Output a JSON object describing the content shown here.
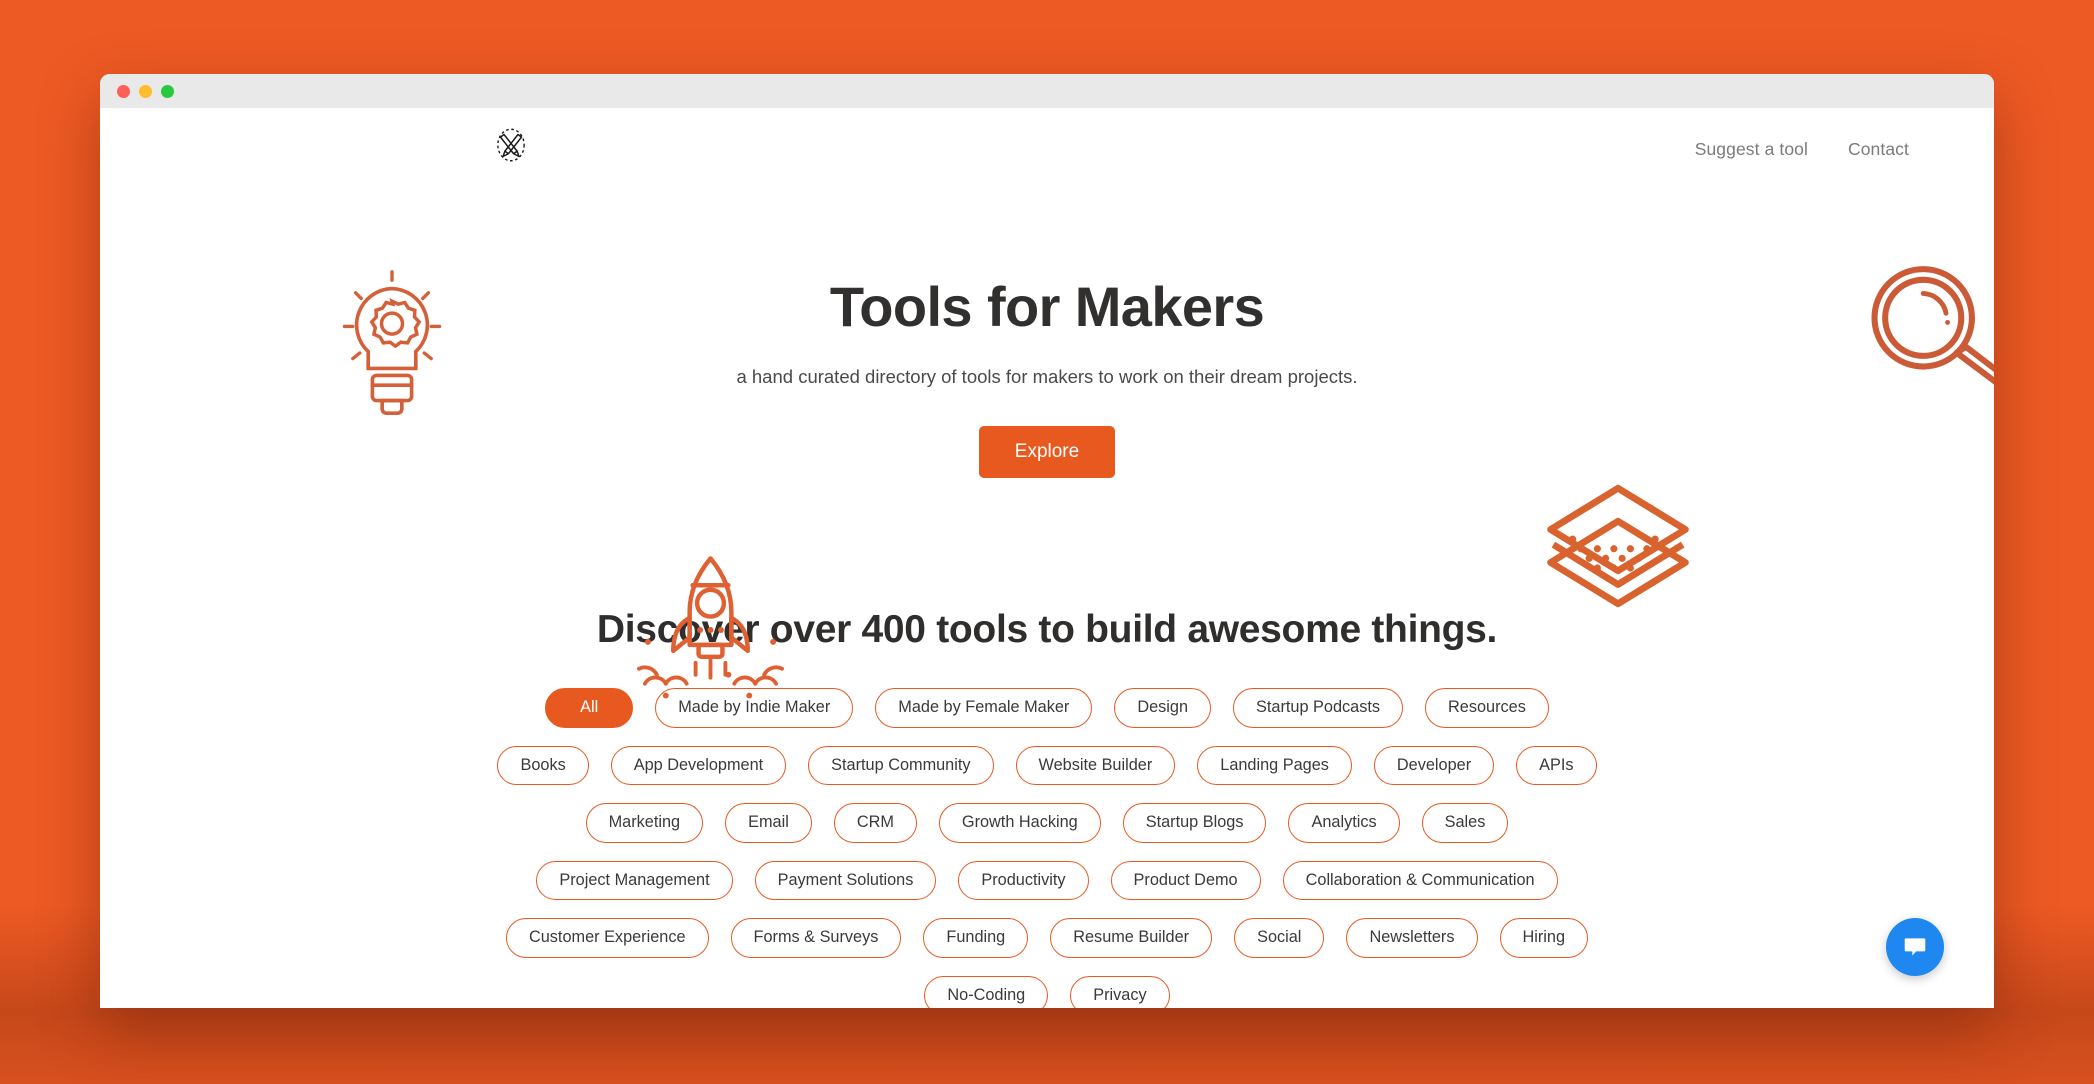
{
  "window": {
    "traffic_lights": [
      "close",
      "minimize",
      "maximize"
    ],
    "colors": {
      "close": "#FF5F57",
      "minimize": "#FFBD2E",
      "maximize": "#28C840"
    }
  },
  "theme": {
    "page_background": "#EE5A24",
    "accent": "#E8591F",
    "text_dark": "#31302F",
    "chat_blue": "#1E88F0"
  },
  "header": {
    "logo_name": "crossed-pencils-logo",
    "nav": [
      {
        "label": "Suggest a tool"
      },
      {
        "label": "Contact"
      }
    ]
  },
  "hero": {
    "title": "Tools for Makers",
    "subtitle": "a hand curated directory of tools for makers to work on their dream projects.",
    "cta_label": "Explore",
    "illustrations": [
      {
        "name": "lightbulb-gear-illustration"
      },
      {
        "name": "magnifying-glass-illustration"
      },
      {
        "name": "rocket-launch-illustration"
      },
      {
        "name": "stacked-layers-illustration"
      }
    ]
  },
  "discover": {
    "heading": "Discover over 400 tools to build awesome things.",
    "categories": [
      {
        "label": "All",
        "active": true
      },
      {
        "label": "Made by Indie Maker",
        "active": false
      },
      {
        "label": "Made by Female Maker",
        "active": false
      },
      {
        "label": "Design",
        "active": false
      },
      {
        "label": "Startup Podcasts",
        "active": false
      },
      {
        "label": "Resources",
        "active": false
      },
      {
        "label": "Books",
        "active": false
      },
      {
        "label": "App Development",
        "active": false
      },
      {
        "label": "Startup Community",
        "active": false
      },
      {
        "label": "Website Builder",
        "active": false
      },
      {
        "label": "Landing Pages",
        "active": false
      },
      {
        "label": "Developer",
        "active": false
      },
      {
        "label": "APIs",
        "active": false
      },
      {
        "label": "Marketing",
        "active": false
      },
      {
        "label": "Email",
        "active": false
      },
      {
        "label": "CRM",
        "active": false
      },
      {
        "label": "Growth Hacking",
        "active": false
      },
      {
        "label": "Startup Blogs",
        "active": false
      },
      {
        "label": "Analytics",
        "active": false
      },
      {
        "label": "Sales",
        "active": false
      },
      {
        "label": "Project Management",
        "active": false
      },
      {
        "label": "Payment Solutions",
        "active": false
      },
      {
        "label": "Productivity",
        "active": false
      },
      {
        "label": "Product Demo",
        "active": false
      },
      {
        "label": "Collaboration & Communication",
        "active": false
      },
      {
        "label": "Customer Experience",
        "active": false
      },
      {
        "label": "Forms & Surveys",
        "active": false
      },
      {
        "label": "Funding",
        "active": false
      },
      {
        "label": "Resume Builder",
        "active": false
      },
      {
        "label": "Social",
        "active": false
      },
      {
        "label": "Newsletters",
        "active": false
      },
      {
        "label": "Hiring",
        "active": false
      },
      {
        "label": "No-Coding",
        "active": false
      },
      {
        "label": "Privacy",
        "active": false
      }
    ]
  },
  "chat": {
    "name": "chat-bubble-icon"
  }
}
